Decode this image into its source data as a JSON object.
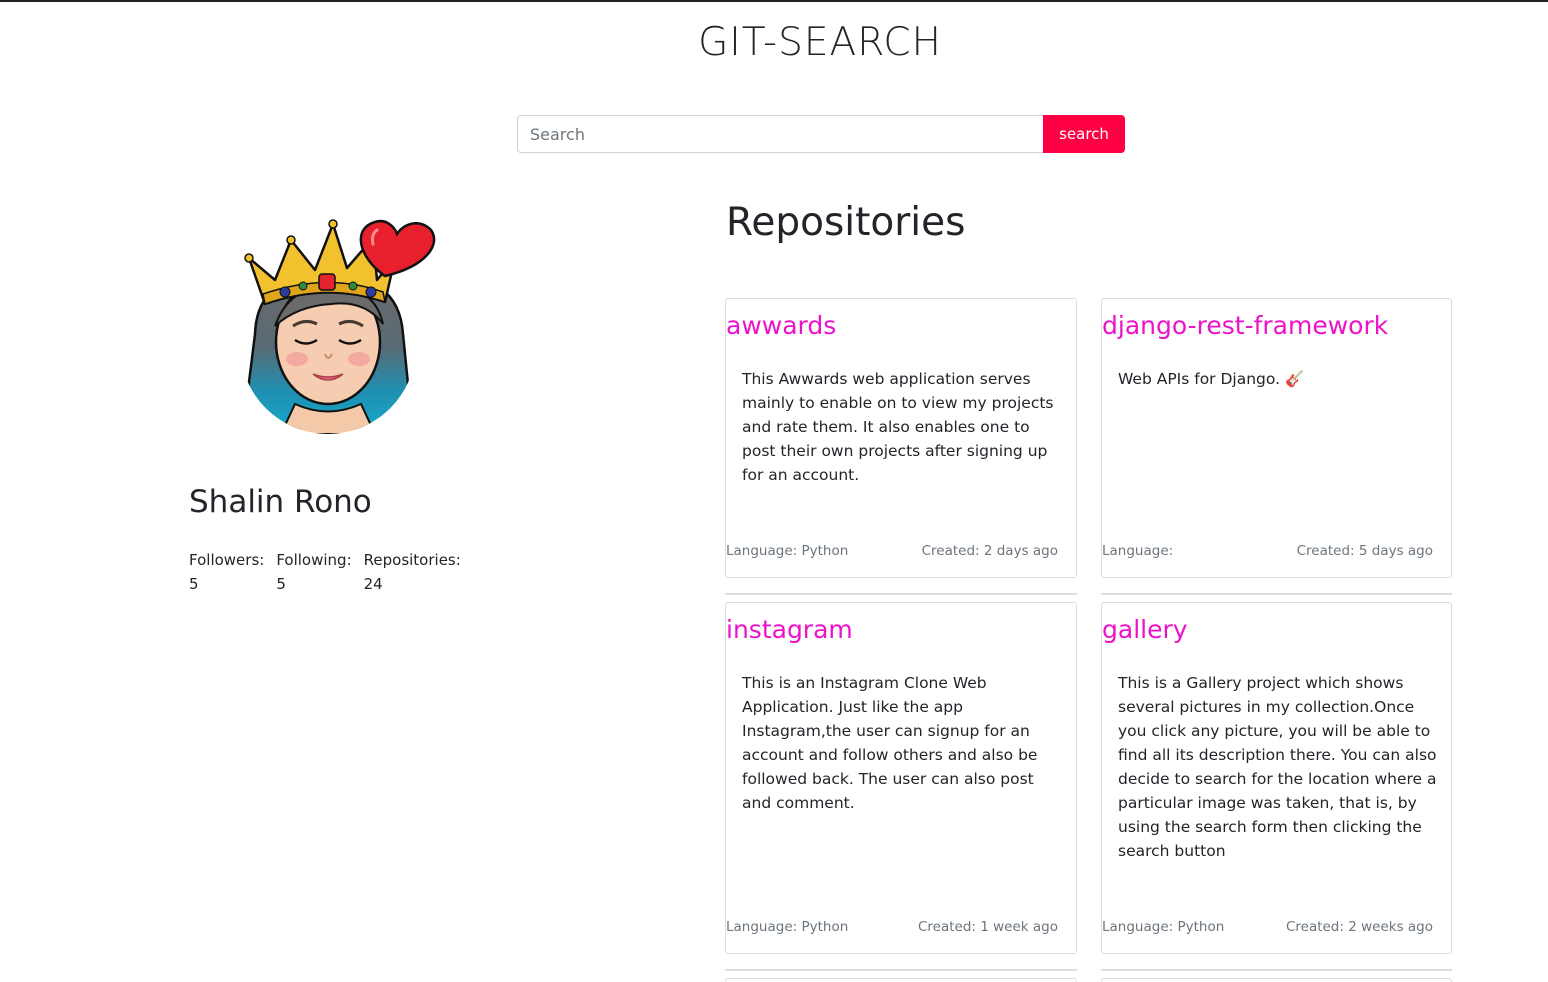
{
  "header": {
    "title": "GIT-SEARCH"
  },
  "search": {
    "placeholder": "Search",
    "value": "",
    "button_label": "search"
  },
  "profile": {
    "name": "Shalin Rono",
    "stats": [
      {
        "label": "Followers:",
        "value": "5"
      },
      {
        "label": "Following:",
        "value": "5"
      },
      {
        "label": "Repositories:",
        "value": "24"
      }
    ]
  },
  "repos": {
    "heading": "Repositories",
    "items": [
      {
        "name": "awwards",
        "description": "This Awwards web application serves mainly to enable on to view my projects and rate them. It also enables one to post their own projects after signing up for an account.",
        "language": "Language: Python",
        "created": "Created: 2 days ago"
      },
      {
        "name": "django-rest-framework",
        "description": "Web APIs for Django. 🎸",
        "language": "Language:",
        "created": "Created: 5 days ago"
      },
      {
        "name": "instagram",
        "description": "This is an Instagram Clone Web Application. Just like the app Instagram,the user can signup for an account and follow others and also be followed back. The user can also post and comment.",
        "language": "Language: Python",
        "created": "Created: 1 week ago"
      },
      {
        "name": "gallery",
        "description": "This is a Gallery project which shows several pictures in my collection.Once you click any picture, you will be able to find all its description there. You can also decide to search for the location where a particular image was taken, that is, by using the search form then clicking the search button",
        "language": "Language: Python",
        "created": "Created: 2 weeks ago"
      }
    ]
  },
  "colors": {
    "accent": "#ff0044",
    "repo_title": "#ee11cc"
  }
}
